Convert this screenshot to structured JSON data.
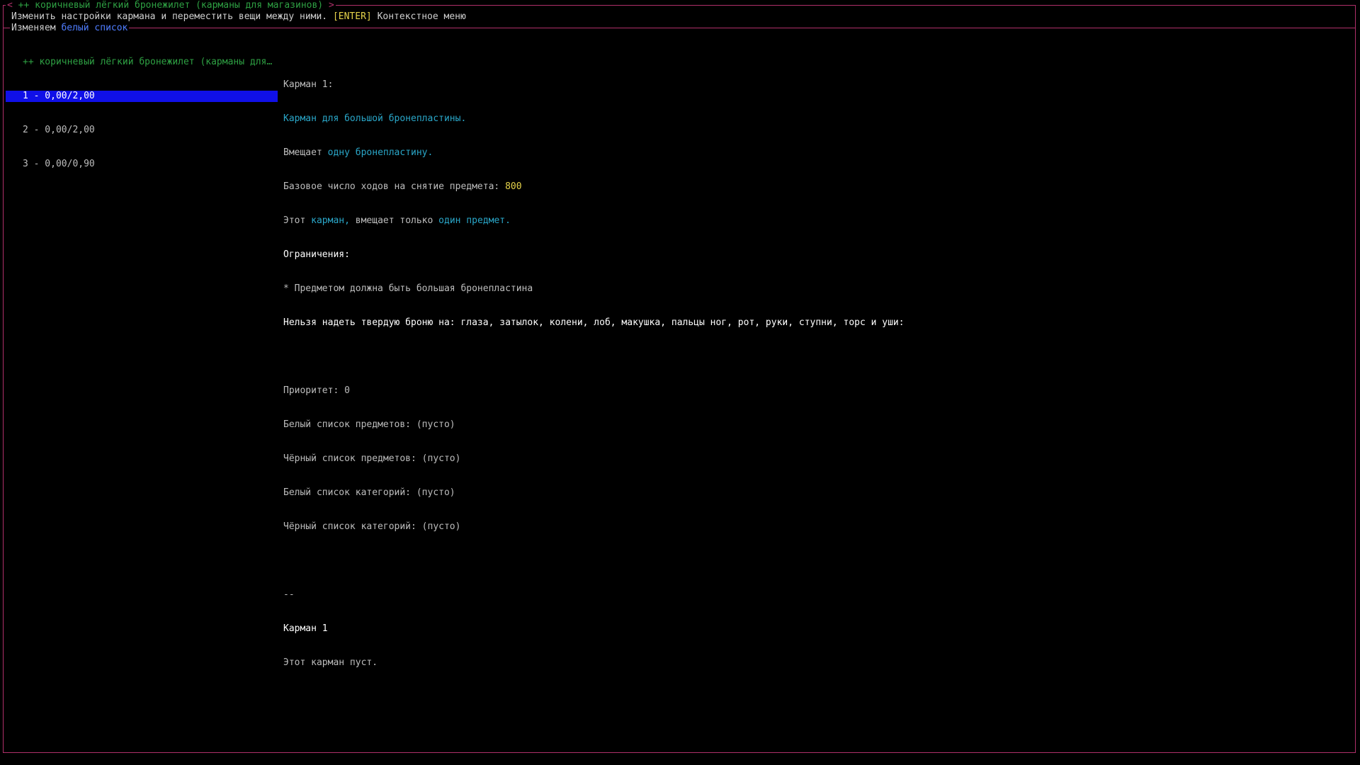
{
  "window": {
    "title_left_bracket": "<",
    "title": "++ коричневый лёгкий бронежилет (карманы для магазинов)",
    "title_right_bracket": ">"
  },
  "help": {
    "text": "Изменить настройки кармана и переместить вещи между ними. ",
    "key": "[ENTER]",
    "key_action": " Контекстное меню"
  },
  "section": {
    "prefix": "Изменяем ",
    "highlight": "белый список"
  },
  "list": {
    "header": "++ коричневый лёгкий бронежилет (карманы для…",
    "items": [
      "1 - 0,00/2,00",
      "2 - 0,00/2,00",
      "3 - 0,00/0,90"
    ]
  },
  "details": {
    "pocket_title": "Карман 1:",
    "description": "Карман для большой бронепластины.",
    "holds_prefix": "Вмещает ",
    "holds_value": "одну бронепластину.",
    "moves_prefix": "Базовое число ходов на снятие предмета: ",
    "moves_value": "800",
    "only_prefix": "Этот ",
    "only_pocket": "карман,",
    "only_mid": " вмещает только ",
    "only_value": "один предмет.",
    "restrictions_label": "Ограничения:",
    "restriction_1": "* Предметом должна быть большая бронепластина",
    "cannot_wear": "Нельзя надеть твердую броню на: глаза, затылок, колени, лоб, макушка, пальцы ног, рот, руки, ступни, торс и уши:",
    "priority": "Приоритет: 0",
    "wl_items": "Белый список предметов: (пусто)",
    "bl_items": "Чёрный список предметов: (пусто)",
    "wl_categories": "Белый список категорий: (пусто)",
    "bl_categories": "Чёрный список категорий: (пусто)",
    "separator": "--",
    "pocket_name": "Карман 1",
    "pocket_empty": "Этот карман пуст."
  },
  "colors": {
    "border": "#b0306a",
    "title": "#2ea043",
    "selection": "#1010e8",
    "highlight_cyan": "#2aa7c9",
    "key_yellow": "#e6d34a"
  }
}
